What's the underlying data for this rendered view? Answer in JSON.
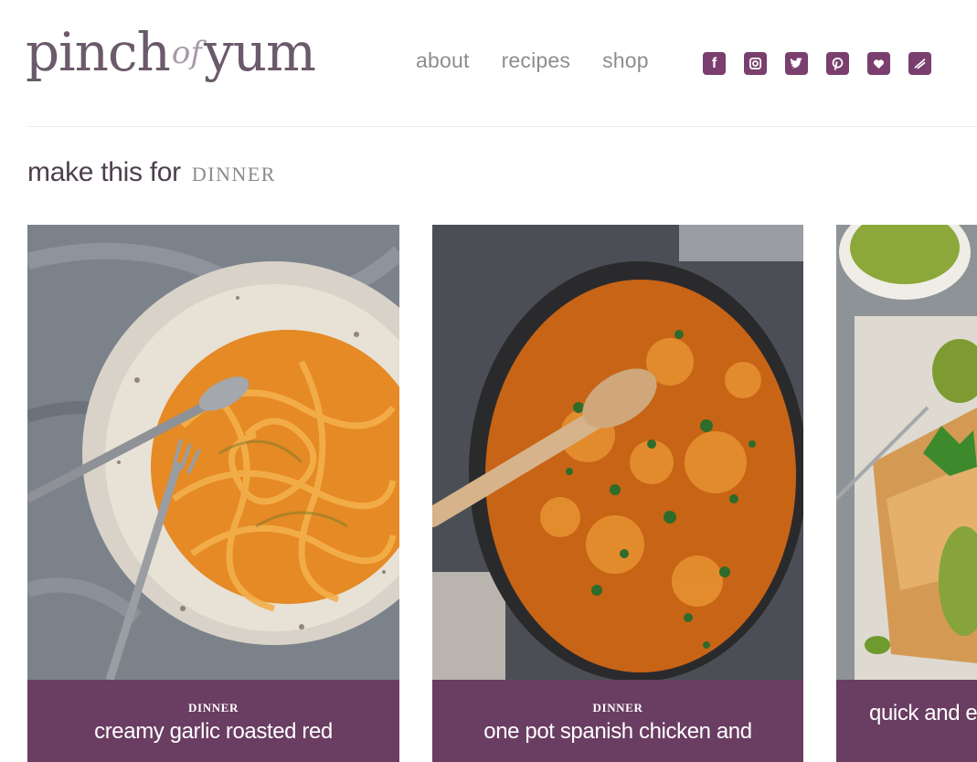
{
  "header": {
    "logo": {
      "part1": "pinch",
      "part2": "of",
      "part3": "yum"
    },
    "nav": [
      "about",
      "recipes",
      "shop"
    ],
    "social": [
      "facebook-icon",
      "instagram-icon",
      "twitter-icon",
      "pinterest-icon",
      "bloglovin-icon",
      "email-icon"
    ]
  },
  "section": {
    "prefix": "make this for",
    "category": "DINNER"
  },
  "cards": [
    {
      "category": "DINNER",
      "title": "creamy garlic roasted red"
    },
    {
      "category": "DINNER",
      "title": "one pot spanish chicken and"
    },
    {
      "category": "",
      "title": "quick and e"
    }
  ],
  "colors": {
    "brand": "#6a3d62",
    "nav_text": "#8d8d8d",
    "heading": "#4d3f4d"
  }
}
